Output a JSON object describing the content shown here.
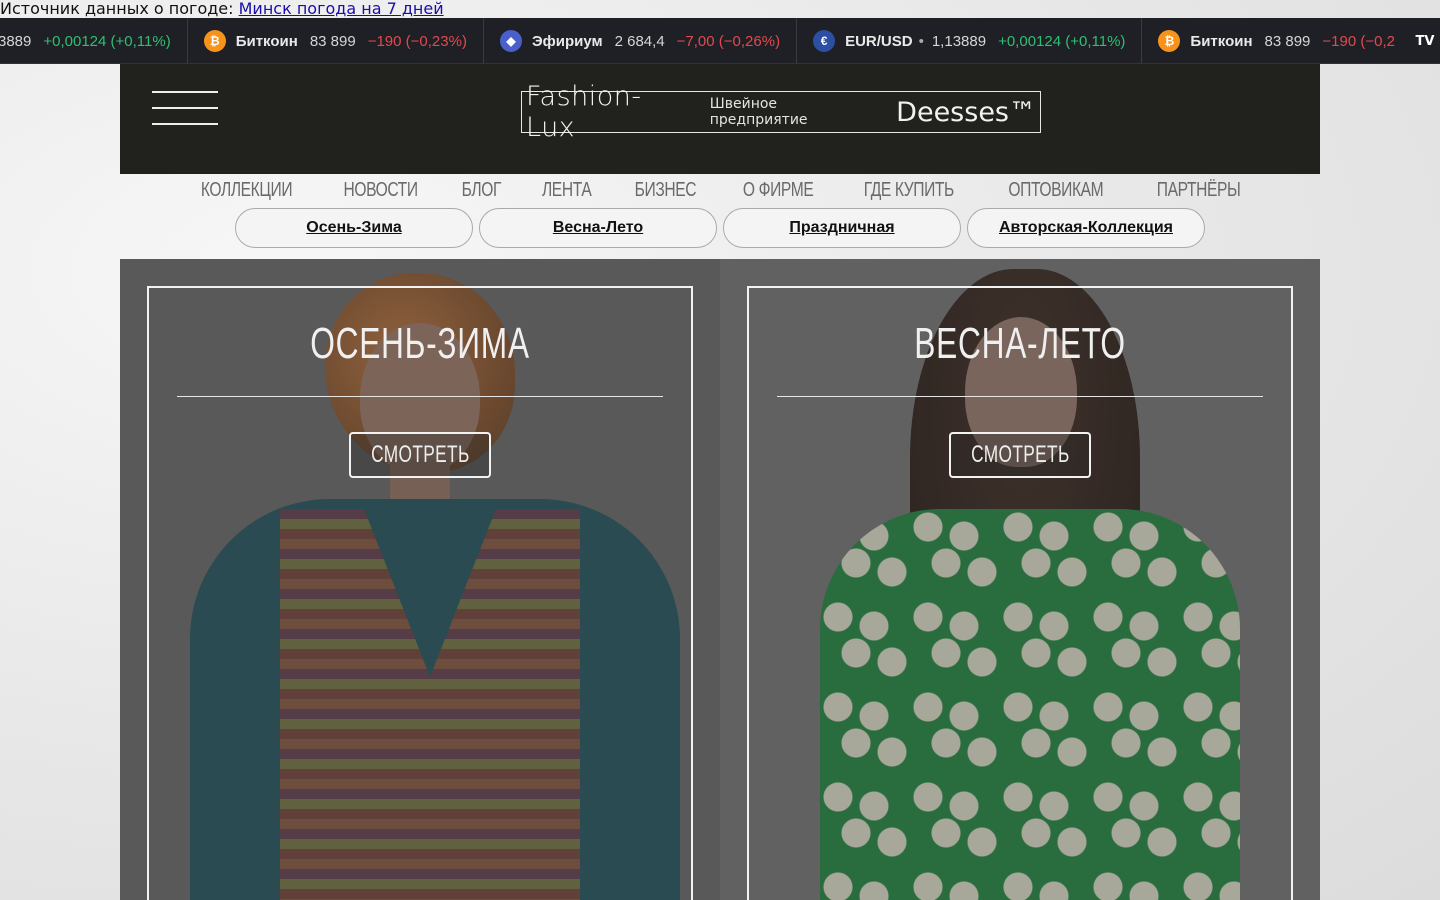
{
  "weather": {
    "label": "Источник данных о погоде: ",
    "link": "Минск погода на 7 дней"
  },
  "ticker": {
    "items": [
      {
        "icon": "eur-usd-icon",
        "name": "",
        "price": "3889",
        "change": "+0,00124 (+0,11%)",
        "dir": "up",
        "partial": true
      },
      {
        "icon": "bitcoin-icon",
        "name": "Биткоин",
        "price": "83 899",
        "change": "−190 (−0,23%)",
        "dir": "down"
      },
      {
        "icon": "ethereum-icon",
        "name": "Эфириум",
        "price": "2 684,4",
        "change": "−7,00 (−0,26%)",
        "dir": "down"
      },
      {
        "icon": "eur-usd-icon",
        "name": "EUR/USD",
        "price": "1,13889",
        "change": "+0,00124 (+0,11%)",
        "dir": "up"
      },
      {
        "icon": "bitcoin-icon",
        "name": "Биткоин",
        "price": "83 899",
        "change": "−190 (−0,2",
        "dir": "down"
      }
    ],
    "tv_logo": "TV",
    "colors": {
      "up": "#2fbf71",
      "down": "#e5484d",
      "bg": "#1e2025"
    }
  },
  "header": {
    "logo_main": "Fashion-Lux",
    "logo_sub": "Швейное предприятие",
    "logo_brand": "Deesses™"
  },
  "main_nav": {
    "items": [
      "КОЛЛЕКЦИИ",
      "НОВОСТИ",
      "БЛОГ",
      "ЛЕНТА",
      "БИЗНЕС",
      "О ФИРМЕ",
      "ГДЕ КУПИТЬ",
      "ОПТОВИКАМ",
      "ПАРТНЁРЫ"
    ]
  },
  "sub_nav": {
    "items": [
      "Осень-Зима",
      "Весна-Лето",
      "Праздничная",
      "Авторская-Коллекция"
    ]
  },
  "collections": [
    {
      "title": "ОСЕНЬ-ЗИМА",
      "button": "СМОТРЕТЬ"
    },
    {
      "title": "ВЕСНА-ЛЕТО",
      "button": "СМОТРЕТЬ"
    }
  ]
}
